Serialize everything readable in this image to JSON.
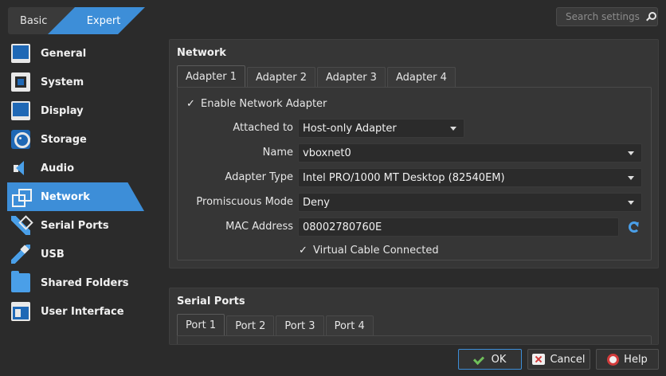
{
  "mode": {
    "basic": "Basic",
    "expert": "Expert"
  },
  "search": {
    "placeholder": "Search settings"
  },
  "sidebar": {
    "items": [
      {
        "label": "General",
        "icon": "general-icon"
      },
      {
        "label": "System",
        "icon": "system-icon"
      },
      {
        "label": "Display",
        "icon": "display-icon"
      },
      {
        "label": "Storage",
        "icon": "storage-icon"
      },
      {
        "label": "Audio",
        "icon": "audio-icon"
      },
      {
        "label": "Network",
        "icon": "network-icon",
        "active": true
      },
      {
        "label": "Serial Ports",
        "icon": "serial-ports-icon"
      },
      {
        "label": "USB",
        "icon": "usb-icon"
      },
      {
        "label": "Shared Folders",
        "icon": "shared-folders-icon"
      },
      {
        "label": "User Interface",
        "icon": "user-interface-icon"
      }
    ]
  },
  "network": {
    "title": "Network",
    "tabs": [
      "Adapter 1",
      "Adapter 2",
      "Adapter 3",
      "Adapter 4"
    ],
    "enable_label": "Enable Network Adapter",
    "attached_label": "Attached to",
    "attached_value": "Host-only Adapter",
    "name_label": "Name",
    "name_value": "vboxnet0",
    "type_label": "Adapter Type",
    "type_value": "Intel PRO/1000 MT Desktop (82540EM)",
    "promisc_label": "Promiscuous Mode",
    "promisc_value": "Deny",
    "mac_label": "MAC Address",
    "mac_value": "08002780760E",
    "cable_label": "Virtual Cable Connected",
    "check_mark": "✓"
  },
  "serial": {
    "title": "Serial Ports",
    "tabs": [
      "Port 1",
      "Port 2",
      "Port 3",
      "Port 4"
    ]
  },
  "buttons": {
    "ok": "OK",
    "cancel": "Cancel",
    "help": "Help"
  },
  "colors": {
    "accent": "#3d8ed8",
    "background": "#2b2b2b",
    "panel": "#363636"
  }
}
